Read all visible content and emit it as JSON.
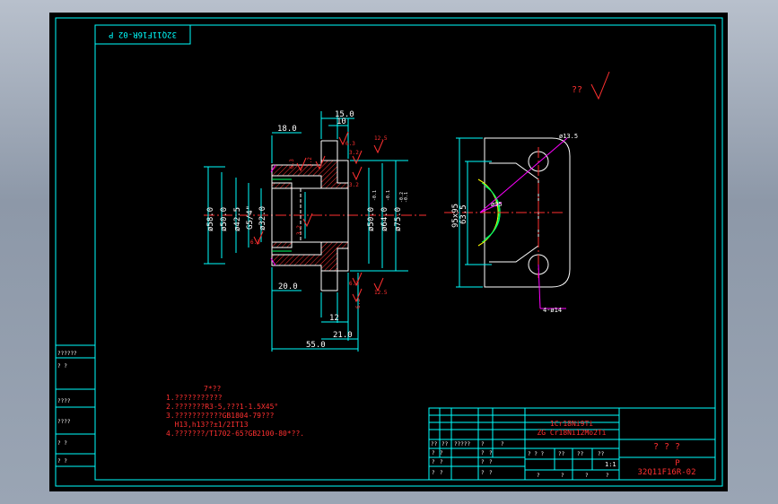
{
  "title_stamp": "32Q11F16R-02 P",
  "roughness_note": "??",
  "views": {
    "section": {
      "dims_top": [
        "18.0",
        "15.0",
        "10"
      ],
      "dims_left": [
        "ø58.0",
        "ø50.0",
        "ø42.5",
        "G5/4\"",
        "ø32.0"
      ],
      "dims_right": [
        "ø50.0",
        "ø64.0",
        "ø75.0"
      ],
      "tol_right": [
        "-0.1",
        "-0.1",
        "-0.2",
        "-0.1"
      ],
      "dims_bottom": [
        "20.0",
        "12",
        "21.0",
        "55.0"
      ],
      "roughness": [
        "6.3",
        "3.2",
        "6.3",
        "12.5",
        "3.2",
        "3.2",
        "3.2",
        "6.3",
        "6.3",
        "6.3",
        "12.5"
      ]
    },
    "plan": {
      "dims": [
        "95x95",
        "63.5",
        "ø95",
        "ø13.5",
        "4-ø14"
      ]
    }
  },
  "notes": {
    "title": "7*??",
    "lines": [
      "1.???????????",
      "2.???????R3-5,???1-1.5X45°",
      "3.???????????GB1804-79???",
      "  H13,h13??±1/2IT13",
      "4.???????/T1702-65?GB2100-80*??."
    ]
  },
  "left_strip": [
    "??????",
    "?    ?",
    "????",
    "????",
    "?    ?",
    "?    ?"
  ],
  "titleblock": {
    "material": [
      "1Cr18Ni9Ti",
      "ZG Cr18Ni12Mo2Ti"
    ],
    "name": "? ? ?",
    "drawing_no": [
      "P",
      "32Q11F16R-02"
    ],
    "header_row": [
      "??",
      "??",
      "?????",
      "?",
      "?"
    ],
    "sign_rows": [
      [
        "?",
        "?",
        "?",
        "?"
      ],
      [
        "?",
        "?",
        "?",
        "?"
      ],
      [
        "?",
        "?",
        "?",
        "?"
      ]
    ],
    "scale_row": [
      "? ? ?",
      "??",
      "??",
      "??"
    ],
    "scale": "1:1",
    "sheet_row": [
      "?",
      "?",
      "?",
      "?"
    ]
  }
}
